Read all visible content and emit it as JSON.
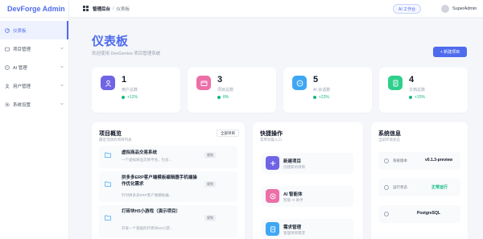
{
  "app": {
    "brand": "DevForge Admin"
  },
  "sidebar": {
    "items": [
      {
        "label": "仪表板",
        "icon": "dashboard-icon",
        "active": true,
        "has_children": false
      },
      {
        "label": "项目管理",
        "icon": "folder-icon",
        "active": false,
        "has_children": true
      },
      {
        "label": "AI 管理",
        "icon": "robot-icon",
        "active": false,
        "has_children": true
      },
      {
        "label": "用户管理",
        "icon": "user-icon",
        "active": false,
        "has_children": true
      },
      {
        "label": "系统设置",
        "icon": "gear-icon",
        "active": false,
        "has_children": true
      }
    ]
  },
  "header": {
    "breadcrumb_root": "管理后台",
    "breadcrumb_separator": "/",
    "breadcrumb_current": "仪表板",
    "ai_button_label": "AI 工作台",
    "user_name": "SuperAdmin"
  },
  "page": {
    "title": "仪表板",
    "subtitle": "欢迎使用 DevGenius 项目管理系统",
    "new_button_label": "+ 新建项目"
  },
  "stats": [
    {
      "value": "1",
      "label": "用户总数",
      "trend": "+12%",
      "icon": "user-icon",
      "color": "#6f63e6"
    },
    {
      "value": "3",
      "label": "项目总数",
      "trend": "8%",
      "icon": "folder-icon",
      "color": "#ec6fa8"
    },
    {
      "value": "5",
      "label": "AI 会话数",
      "trend": "+23%",
      "icon": "chat-icon",
      "color": "#3ea7f5"
    },
    {
      "value": "4",
      "label": "文档总数",
      "trend": "+15%",
      "icon": "document-icon",
      "color": "#2fcf8c"
    }
  ],
  "projects_panel": {
    "title": "项目概览",
    "subtitle": "最近活跃的项目列表",
    "all_button_label": "全部项目",
    "items": [
      {
        "name": "虚拟商品交易系统",
        "desc": "一个虚拟商品交易平台，包含...",
        "tag": "规划"
      },
      {
        "name": "拼多多ERP客户端模板编辑器手机端操作优化需求",
        "desc": "针对拼多多ERP客户端模板编...",
        "tag": "规划"
      },
      {
        "name": "打砖块H5小游戏（演示项目）",
        "desc": "开发一个基础的打砖块H5小游...",
        "tag": "规划"
      }
    ]
  },
  "quick_actions": {
    "title": "快捷操作",
    "subtitle": "常用功能入口",
    "items": [
      {
        "title": "新建项目",
        "desc": "创建新的项目",
        "icon": "plus-icon",
        "color": "#6f63e6"
      },
      {
        "title": "AI 智能体",
        "desc": "智能 AI 助手",
        "icon": "robot-icon",
        "color": "#ec6fa8"
      },
      {
        "title": "需求管理",
        "desc": "管理项目需求",
        "icon": "document-icon",
        "color": "#3ea7f5"
      }
    ]
  },
  "system_info": {
    "title": "系统信息",
    "subtitle": "当前环境状态",
    "items": [
      {
        "label": "系统版本",
        "value": "v0.1.3-preview",
        "value_color": "#111827"
      },
      {
        "label": "运行状态",
        "value": "正常运行",
        "value_color": "#10b981"
      },
      {
        "label": "",
        "value": "PostgreSQL",
        "value_color": "#111827"
      }
    ]
  }
}
